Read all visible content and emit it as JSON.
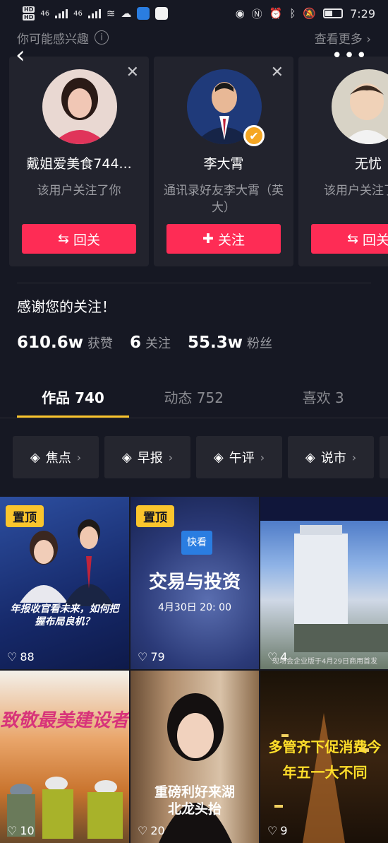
{
  "status": {
    "time": "7:29",
    "net1": "46",
    "net2": "46"
  },
  "suggestions": {
    "title": "你可能感兴趣",
    "more": "查看更多",
    "cards": [
      {
        "name": "戴姐爱美食744...",
        "reason": "该用户关注了你",
        "button": "回关",
        "button_icon": "swap-icon"
      },
      {
        "name": "李大霄",
        "reason": "通讯录好友李大霄（英大）",
        "button": "关注",
        "button_icon": "plus-icon",
        "verified": true
      },
      {
        "name": "无忧",
        "reason": "该用户关注了你",
        "button": "回关",
        "button_icon": "swap-icon"
      }
    ]
  },
  "profile": {
    "bio": "感谢您的关注！",
    "likes_count": "610.6w",
    "likes_label": "获赞",
    "following_count": "6",
    "following_label": "关注",
    "followers_count": "55.3w",
    "followers_label": "粉丝"
  },
  "tabs": [
    {
      "label": "作品 740",
      "active": true
    },
    {
      "label": "动态 752",
      "active": false
    },
    {
      "label": "喜欢 3",
      "active": false
    }
  ],
  "chips": [
    "焦点",
    "早报",
    "午评",
    "说市"
  ],
  "videos": [
    {
      "pinned": true,
      "pin_label": "置顶",
      "likes": "88",
      "caption": "年报收官看未来，如何把握布局良机？"
    },
    {
      "pinned": true,
      "pin_label": "置顶",
      "likes": "79",
      "brand": "快看",
      "caption": "交易与投资",
      "subcaption": "4月30日 20: 00"
    },
    {
      "pinned": false,
      "likes": "4",
      "caption": "现场会企业版于4月29日商用首发"
    },
    {
      "pinned": false,
      "likes": "10",
      "caption": "致敬最美建设者"
    },
    {
      "pinned": false,
      "likes": "20",
      "caption": "重磅利好来湖北龙头抬"
    },
    {
      "pinned": false,
      "likes": "9",
      "caption": "多管齐下促消费今年五一大不同"
    }
  ],
  "colors": {
    "bg": "#161823",
    "accent": "#fe2c55",
    "tab_underline": "#fac52d",
    "pin": "#fac52d"
  }
}
